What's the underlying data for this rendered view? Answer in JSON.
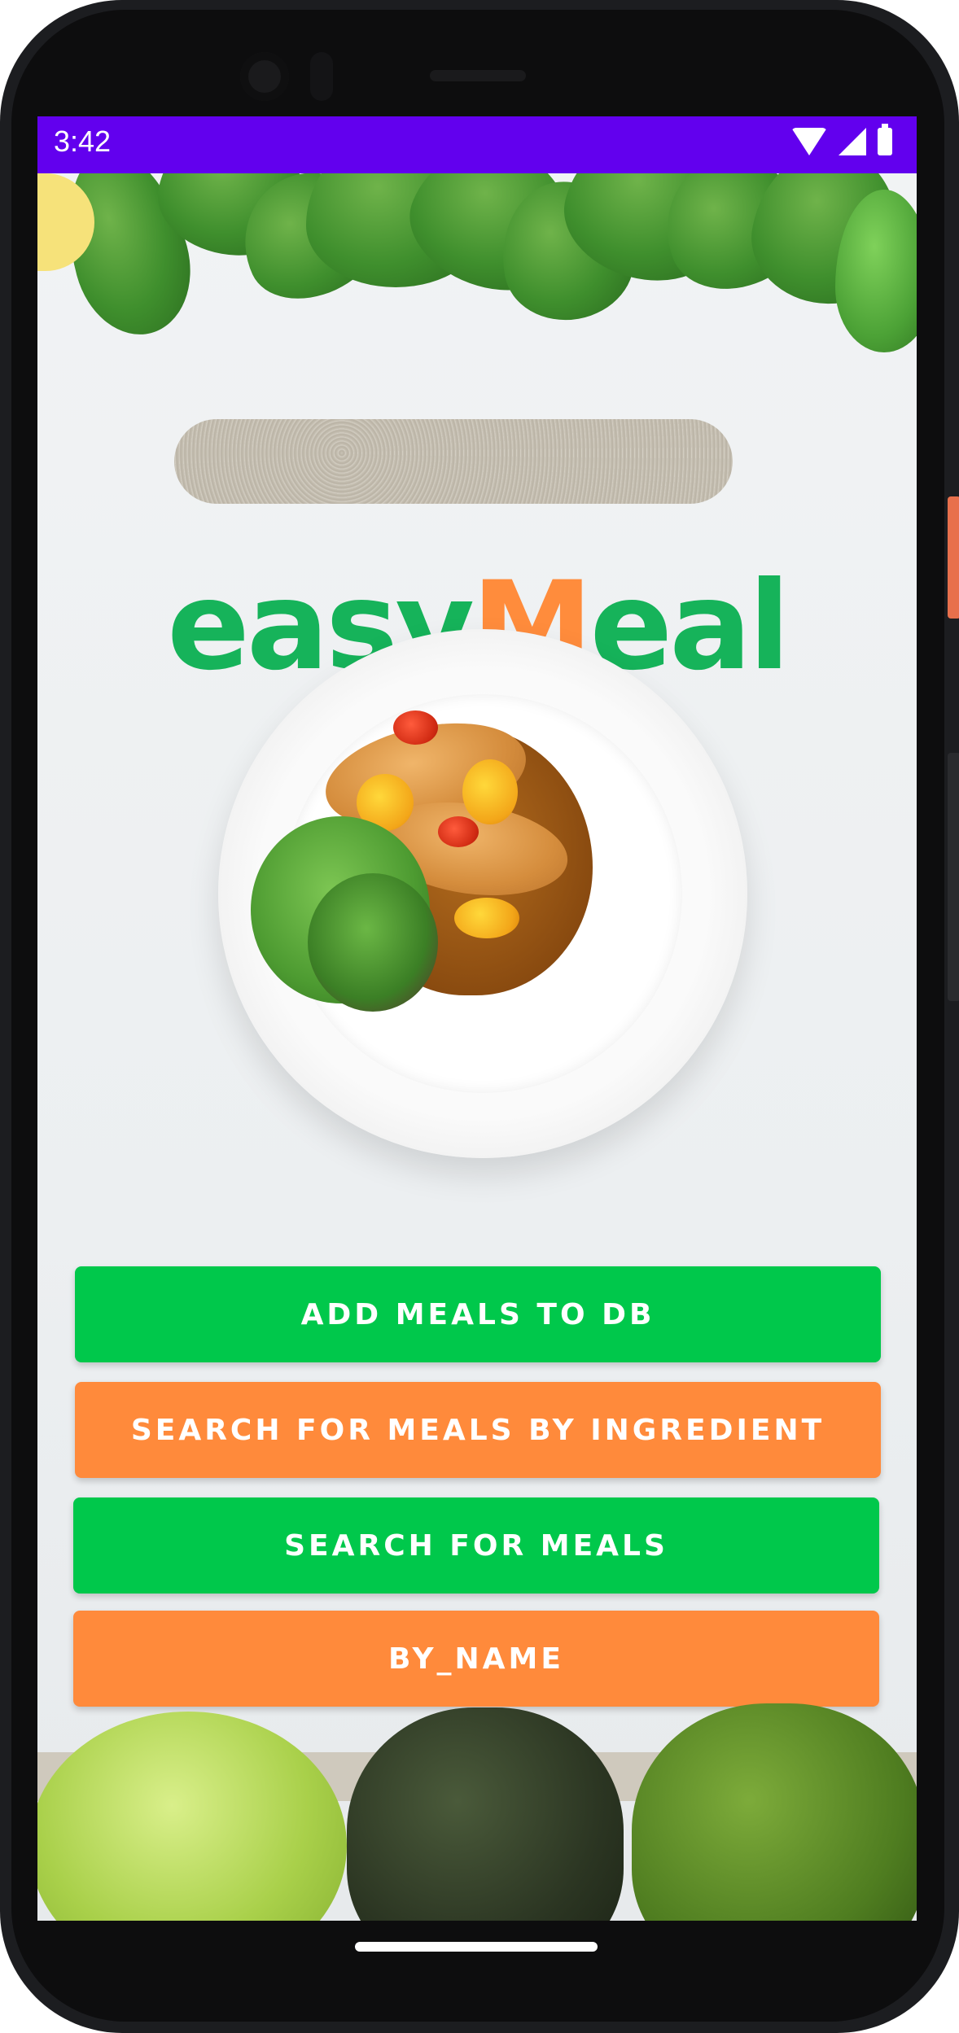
{
  "status_bar": {
    "time": "3:42",
    "icons": [
      "wifi-icon",
      "cellular-signal-icon",
      "battery-icon"
    ],
    "color": "#6200ee"
  },
  "logo": {
    "part1": "easy",
    "part2": "M",
    "part3": "eal",
    "colors": {
      "green": "#16b35a",
      "orange": "#ff8c3c"
    }
  },
  "hero_image": {
    "description_icon": "meal-plate-image"
  },
  "buttons": [
    {
      "label": "ADD MEALS TO DB",
      "color": "#00c84b"
    },
    {
      "label": "SEARCH FOR MEALS BY INGREDIENT",
      "color": "#ff8a3b"
    },
    {
      "label": "SEARCH FOR MEALS",
      "color": "#00c84b"
    },
    {
      "label": "BY_NAME",
      "color": "#ff8a3b"
    }
  ]
}
